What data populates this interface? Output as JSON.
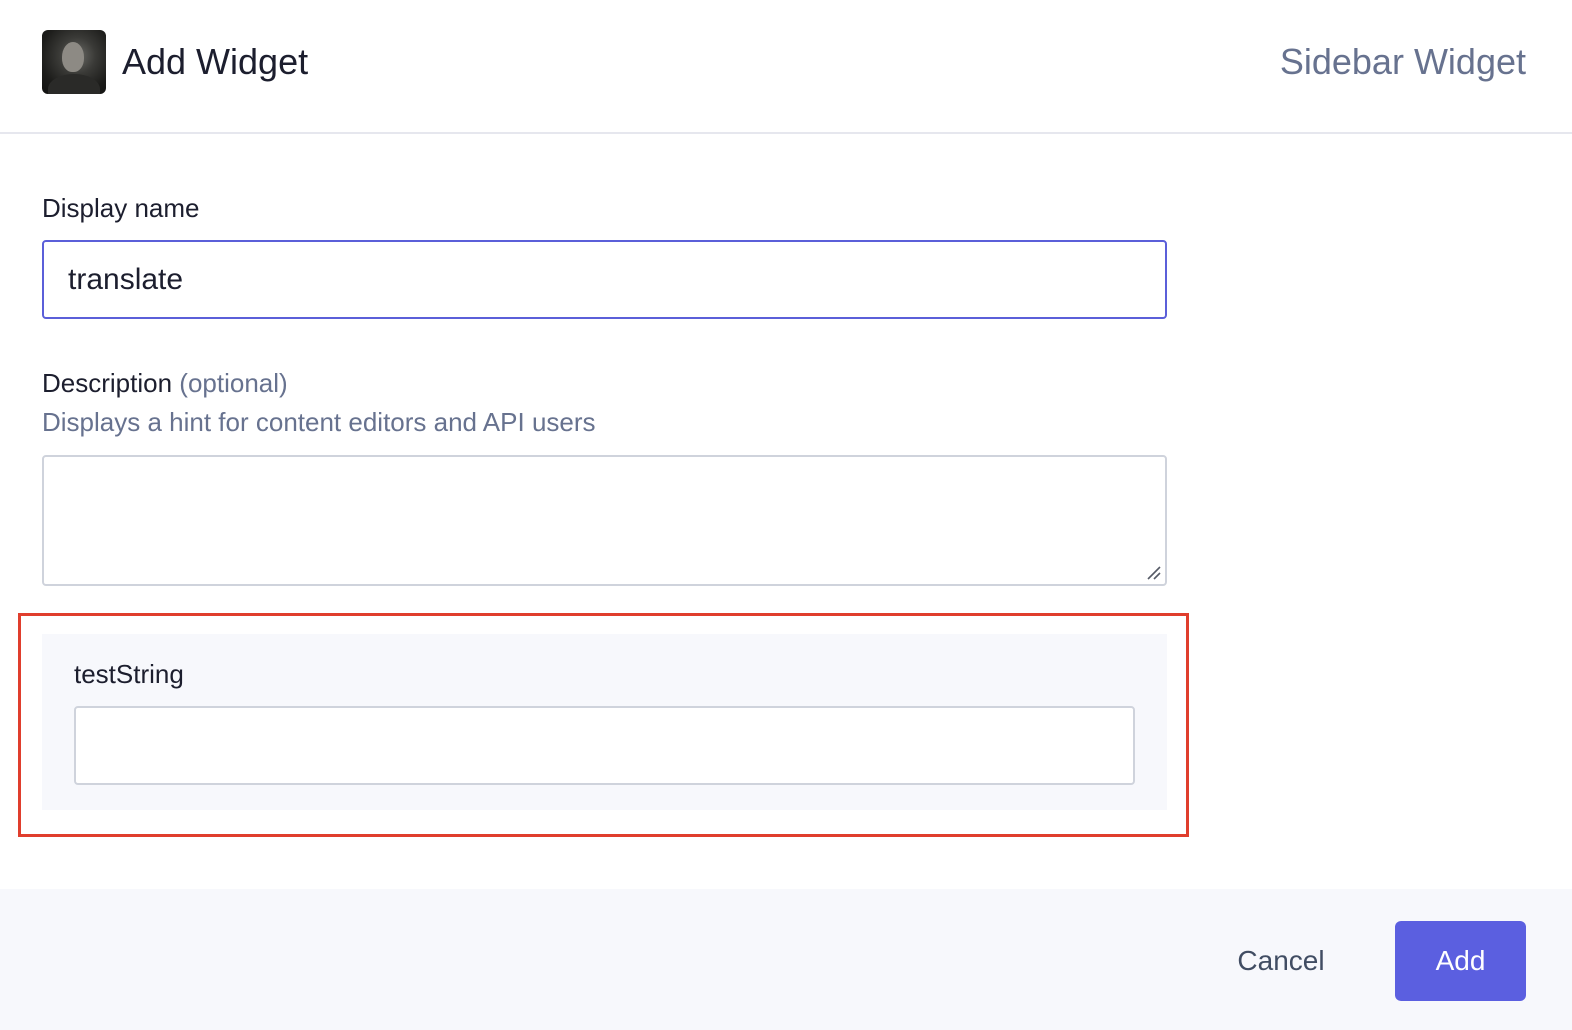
{
  "header": {
    "title": "Add Widget",
    "subtitle": "Sidebar Widget"
  },
  "form": {
    "display_name": {
      "label": "Display name",
      "value": "translate"
    },
    "description": {
      "label": "Description",
      "optional_label": "(optional)",
      "hint": "Displays a hint for content editors and API users",
      "value": ""
    },
    "parameter": {
      "label": "testString",
      "value": ""
    }
  },
  "footer": {
    "cancel_label": "Cancel",
    "add_label": "Add"
  },
  "colors": {
    "accent": "#5b5fe0",
    "focus_border": "#5b5fd9",
    "highlight": "#e03e2d",
    "muted_text": "#67728f",
    "panel_bg": "#f7f8fc"
  }
}
